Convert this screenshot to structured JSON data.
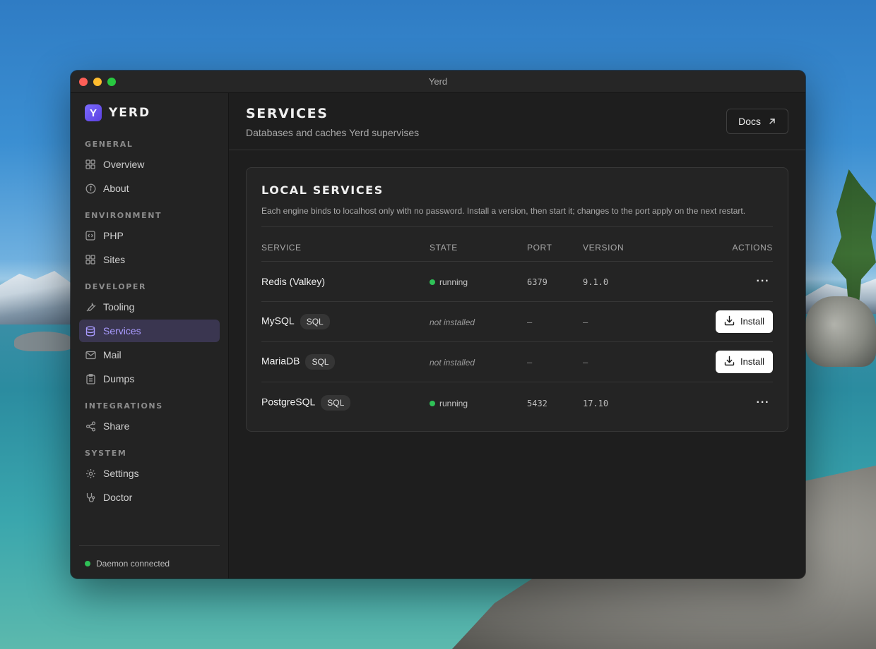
{
  "window": {
    "title": "Yerd"
  },
  "brand": {
    "logo_letter": "Y",
    "name": "YERD",
    "accent": "#6f5cff"
  },
  "sidebar": {
    "sections": [
      {
        "label": "General",
        "items": [
          {
            "label": "Overview",
            "icon": "grid-icon"
          },
          {
            "label": "About",
            "icon": "info-icon"
          }
        ]
      },
      {
        "label": "Environment",
        "items": [
          {
            "label": "PHP",
            "icon": "code-icon"
          },
          {
            "label": "Sites",
            "icon": "grid-icon"
          }
        ]
      },
      {
        "label": "Developer",
        "items": [
          {
            "label": "Tooling",
            "icon": "wrench-icon"
          },
          {
            "label": "Services",
            "icon": "database-icon",
            "active": true
          },
          {
            "label": "Mail",
            "icon": "mail-icon"
          },
          {
            "label": "Dumps",
            "icon": "clipboard-icon"
          }
        ]
      },
      {
        "label": "Integrations",
        "items": [
          {
            "label": "Share",
            "icon": "share-icon"
          }
        ]
      },
      {
        "label": "System",
        "items": [
          {
            "label": "Settings",
            "icon": "gear-icon"
          },
          {
            "label": "Doctor",
            "icon": "stethoscope-icon"
          }
        ]
      }
    ],
    "footer": {
      "status": "Daemon connected",
      "status_color": "#2fc157"
    }
  },
  "header": {
    "title": "Services",
    "subtitle": "Databases and caches Yerd supervises",
    "docs_label": "Docs"
  },
  "card": {
    "title": "Local services",
    "description": "Each engine binds to localhost only with no password. Install a version, then start it; changes to the port apply on the next restart.",
    "columns": [
      "Service",
      "State",
      "Port",
      "Version",
      "Actions"
    ],
    "rows": [
      {
        "name": "Redis (Valkey)",
        "badge": "",
        "state": "running",
        "port": "6379",
        "version": "9.1.0",
        "action": "more"
      },
      {
        "name": "MySQL",
        "badge": "SQL",
        "state": "not installed",
        "port": "–",
        "version": "–",
        "action": "install"
      },
      {
        "name": "MariaDB",
        "badge": "SQL",
        "state": "not installed",
        "port": "–",
        "version": "–",
        "action": "install"
      },
      {
        "name": "PostgreSQL",
        "badge": "SQL",
        "state": "running",
        "port": "5432",
        "version": "17.10",
        "action": "more"
      }
    ],
    "install_label": "Install",
    "more_label": "···",
    "running_color": "#2fc157"
  }
}
